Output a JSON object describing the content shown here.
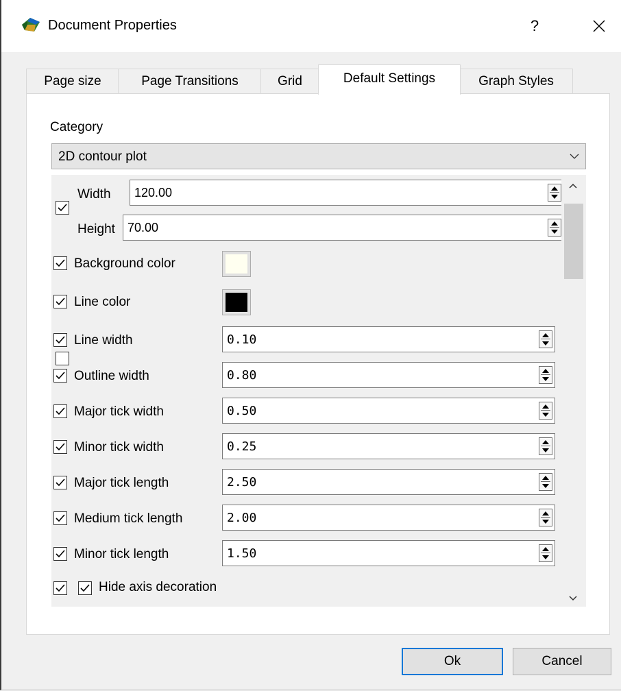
{
  "window": {
    "title": "Document Properties",
    "help_label": "?",
    "icon": "app-logo-icon",
    "close_icon": "close-icon"
  },
  "tabs": [
    {
      "label": "Page size",
      "active": false
    },
    {
      "label": "Page Transitions",
      "active": false
    },
    {
      "label": "Grid",
      "active": false
    },
    {
      "label": "Default Settings",
      "active": true
    },
    {
      "label": "Graph Styles",
      "active": false
    }
  ],
  "category": {
    "label": "Category",
    "selected": "2D contour plot"
  },
  "settings": {
    "width_label": "Width",
    "width_value": "120.00",
    "height_label": "Height",
    "height_value": "70.00",
    "size_checked": true,
    "background_color": {
      "label": "Background color",
      "checked": true,
      "color": "#fffff0"
    },
    "line_color": {
      "label": "Line color",
      "checked": true,
      "color": "#000000"
    },
    "rows": [
      {
        "label": "Line width",
        "value": "0.10",
        "checked": true
      },
      {
        "label": "Outline width",
        "value": "0.80",
        "checked": true
      },
      {
        "label": "Major tick width",
        "value": "0.50",
        "checked": true
      },
      {
        "label": "Minor tick width",
        "value": "0.25",
        "checked": true
      },
      {
        "label": "Major tick length",
        "value": "2.50",
        "checked": true
      },
      {
        "label": "Medium tick length",
        "value": "2.00",
        "checked": true
      },
      {
        "label": "Minor tick length",
        "value": "1.50",
        "checked": true
      }
    ],
    "hide_axis": {
      "label": "Hide axis decoration",
      "checked": true,
      "inner_checked": true
    }
  },
  "buttons": {
    "ok": "Ok",
    "cancel": "Cancel"
  },
  "colors": {
    "accent": "#0078d7",
    "window_bg": "#f0f0f0"
  }
}
